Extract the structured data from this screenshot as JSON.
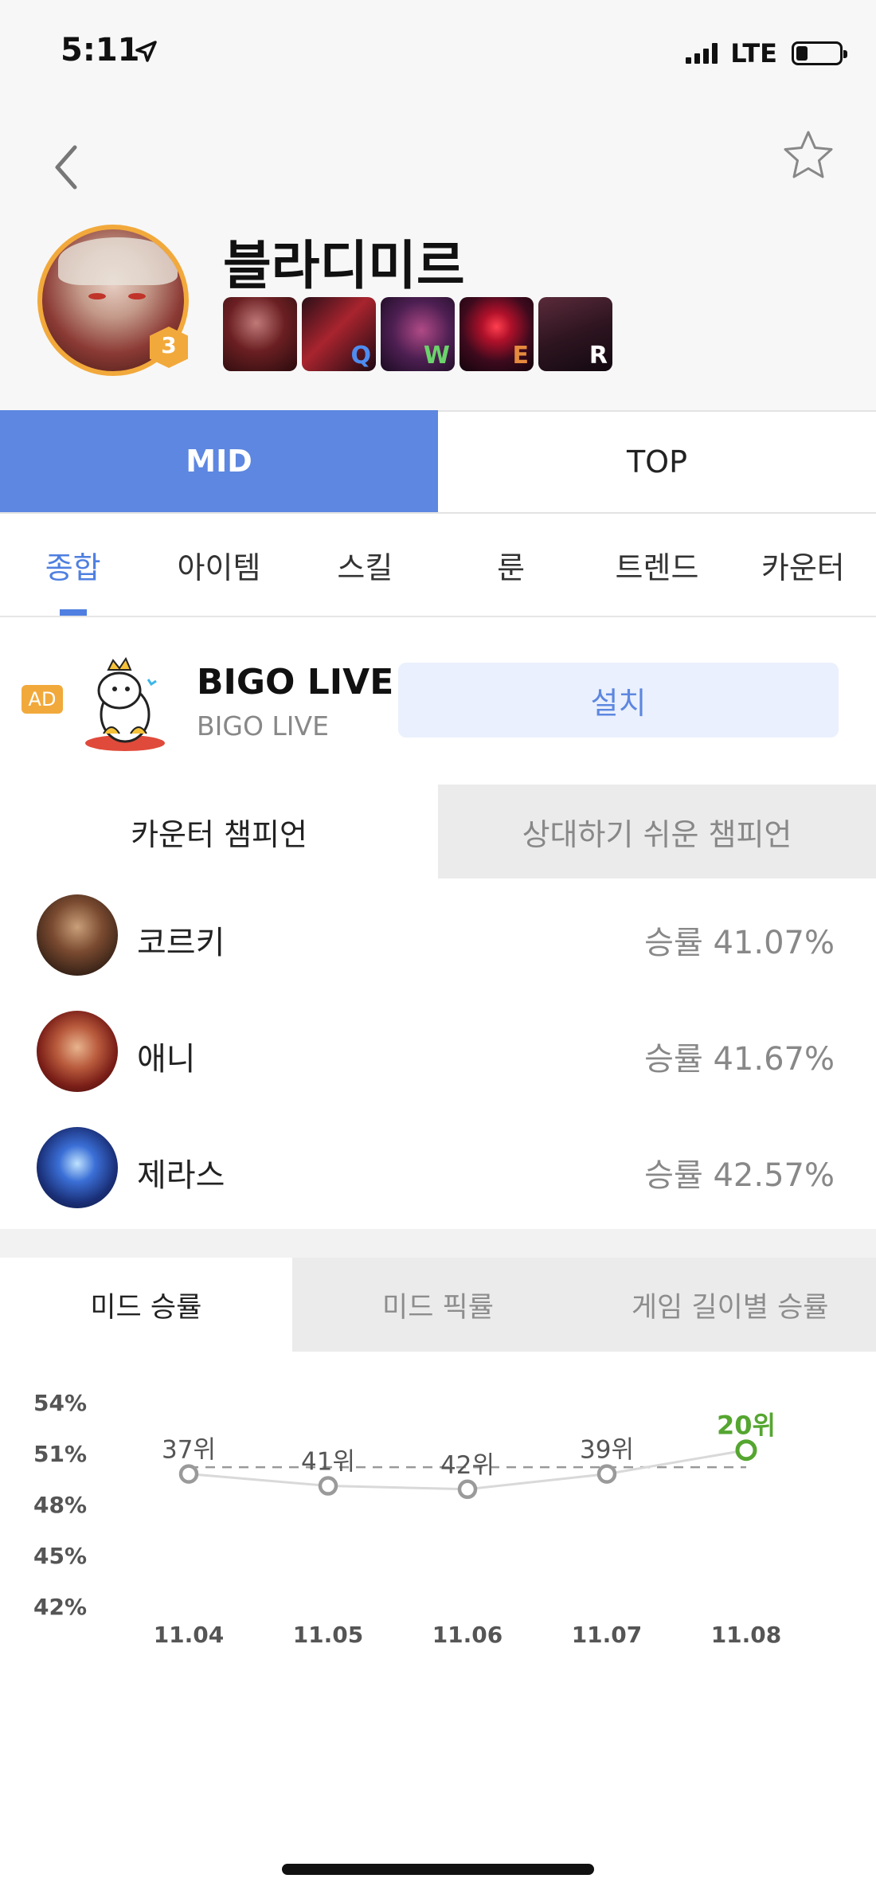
{
  "status_bar": {
    "time": "5:11",
    "network": "LTE"
  },
  "header": {
    "champion_name": "블라디미르",
    "level": "3",
    "skills": [
      {
        "key": "",
        "icon": "passive-skill-icon"
      },
      {
        "key": "Q",
        "icon": "q-skill-icon",
        "color": "#4e8cf0"
      },
      {
        "key": "W",
        "icon": "w-skill-icon",
        "color": "#6bd36b"
      },
      {
        "key": "E",
        "icon": "e-skill-icon",
        "color": "#e58a3e"
      },
      {
        "key": "R",
        "icon": "r-skill-icon",
        "color": "#ffffff"
      }
    ]
  },
  "lanes": [
    {
      "label": "MID",
      "active": true
    },
    {
      "label": "TOP",
      "active": false
    }
  ],
  "sections": [
    {
      "label": "종합",
      "active": true
    },
    {
      "label": "아이템"
    },
    {
      "label": "스킬"
    },
    {
      "label": "룬"
    },
    {
      "label": "트렌드"
    },
    {
      "label": "카운터"
    }
  ],
  "ad": {
    "badge": "AD",
    "title": "BIGO LIVE",
    "subtitle": "BIGO LIVE",
    "install_label": "설치"
  },
  "counter_tabs": [
    {
      "label": "카운터 챔피언",
      "active": true
    },
    {
      "label": "상대하기 쉬운 챔피언",
      "active": false
    }
  ],
  "counters": [
    {
      "name": "코르키",
      "rate": "승률 41.07%"
    },
    {
      "name": "애니",
      "rate": "승률 41.67%"
    },
    {
      "name": "제라스",
      "rate": "승률 42.57%"
    }
  ],
  "chart_tabs": [
    {
      "label": "미드 승률",
      "active": true
    },
    {
      "label": "미드 픽률",
      "active": false
    },
    {
      "label": "게임 길이별 승률",
      "active": false
    }
  ],
  "chart_data": {
    "type": "line",
    "title": "",
    "xlabel": "",
    "ylabel": "",
    "ylim": [
      42,
      54
    ],
    "y_ticks": [
      "54%",
      "51%",
      "48%",
      "45%",
      "42%"
    ],
    "y_tick_values": [
      54,
      51,
      48,
      45,
      42
    ],
    "categories": [
      "11.04",
      "11.05",
      "11.06",
      "11.07",
      "11.08"
    ],
    "series": [
      {
        "values": [
          49.8,
          49.1,
          48.9,
          49.8,
          51.2
        ],
        "rank_labels": [
          "37위",
          "41위",
          "42위",
          "39위",
          "20위"
        ]
      }
    ],
    "average_line": 50.2,
    "colors": {
      "line": "#d9d9d9",
      "marker": "#9a9a9a",
      "highlight": "#55a630",
      "average": "#999999"
    },
    "grid": false,
    "legend": "none"
  }
}
